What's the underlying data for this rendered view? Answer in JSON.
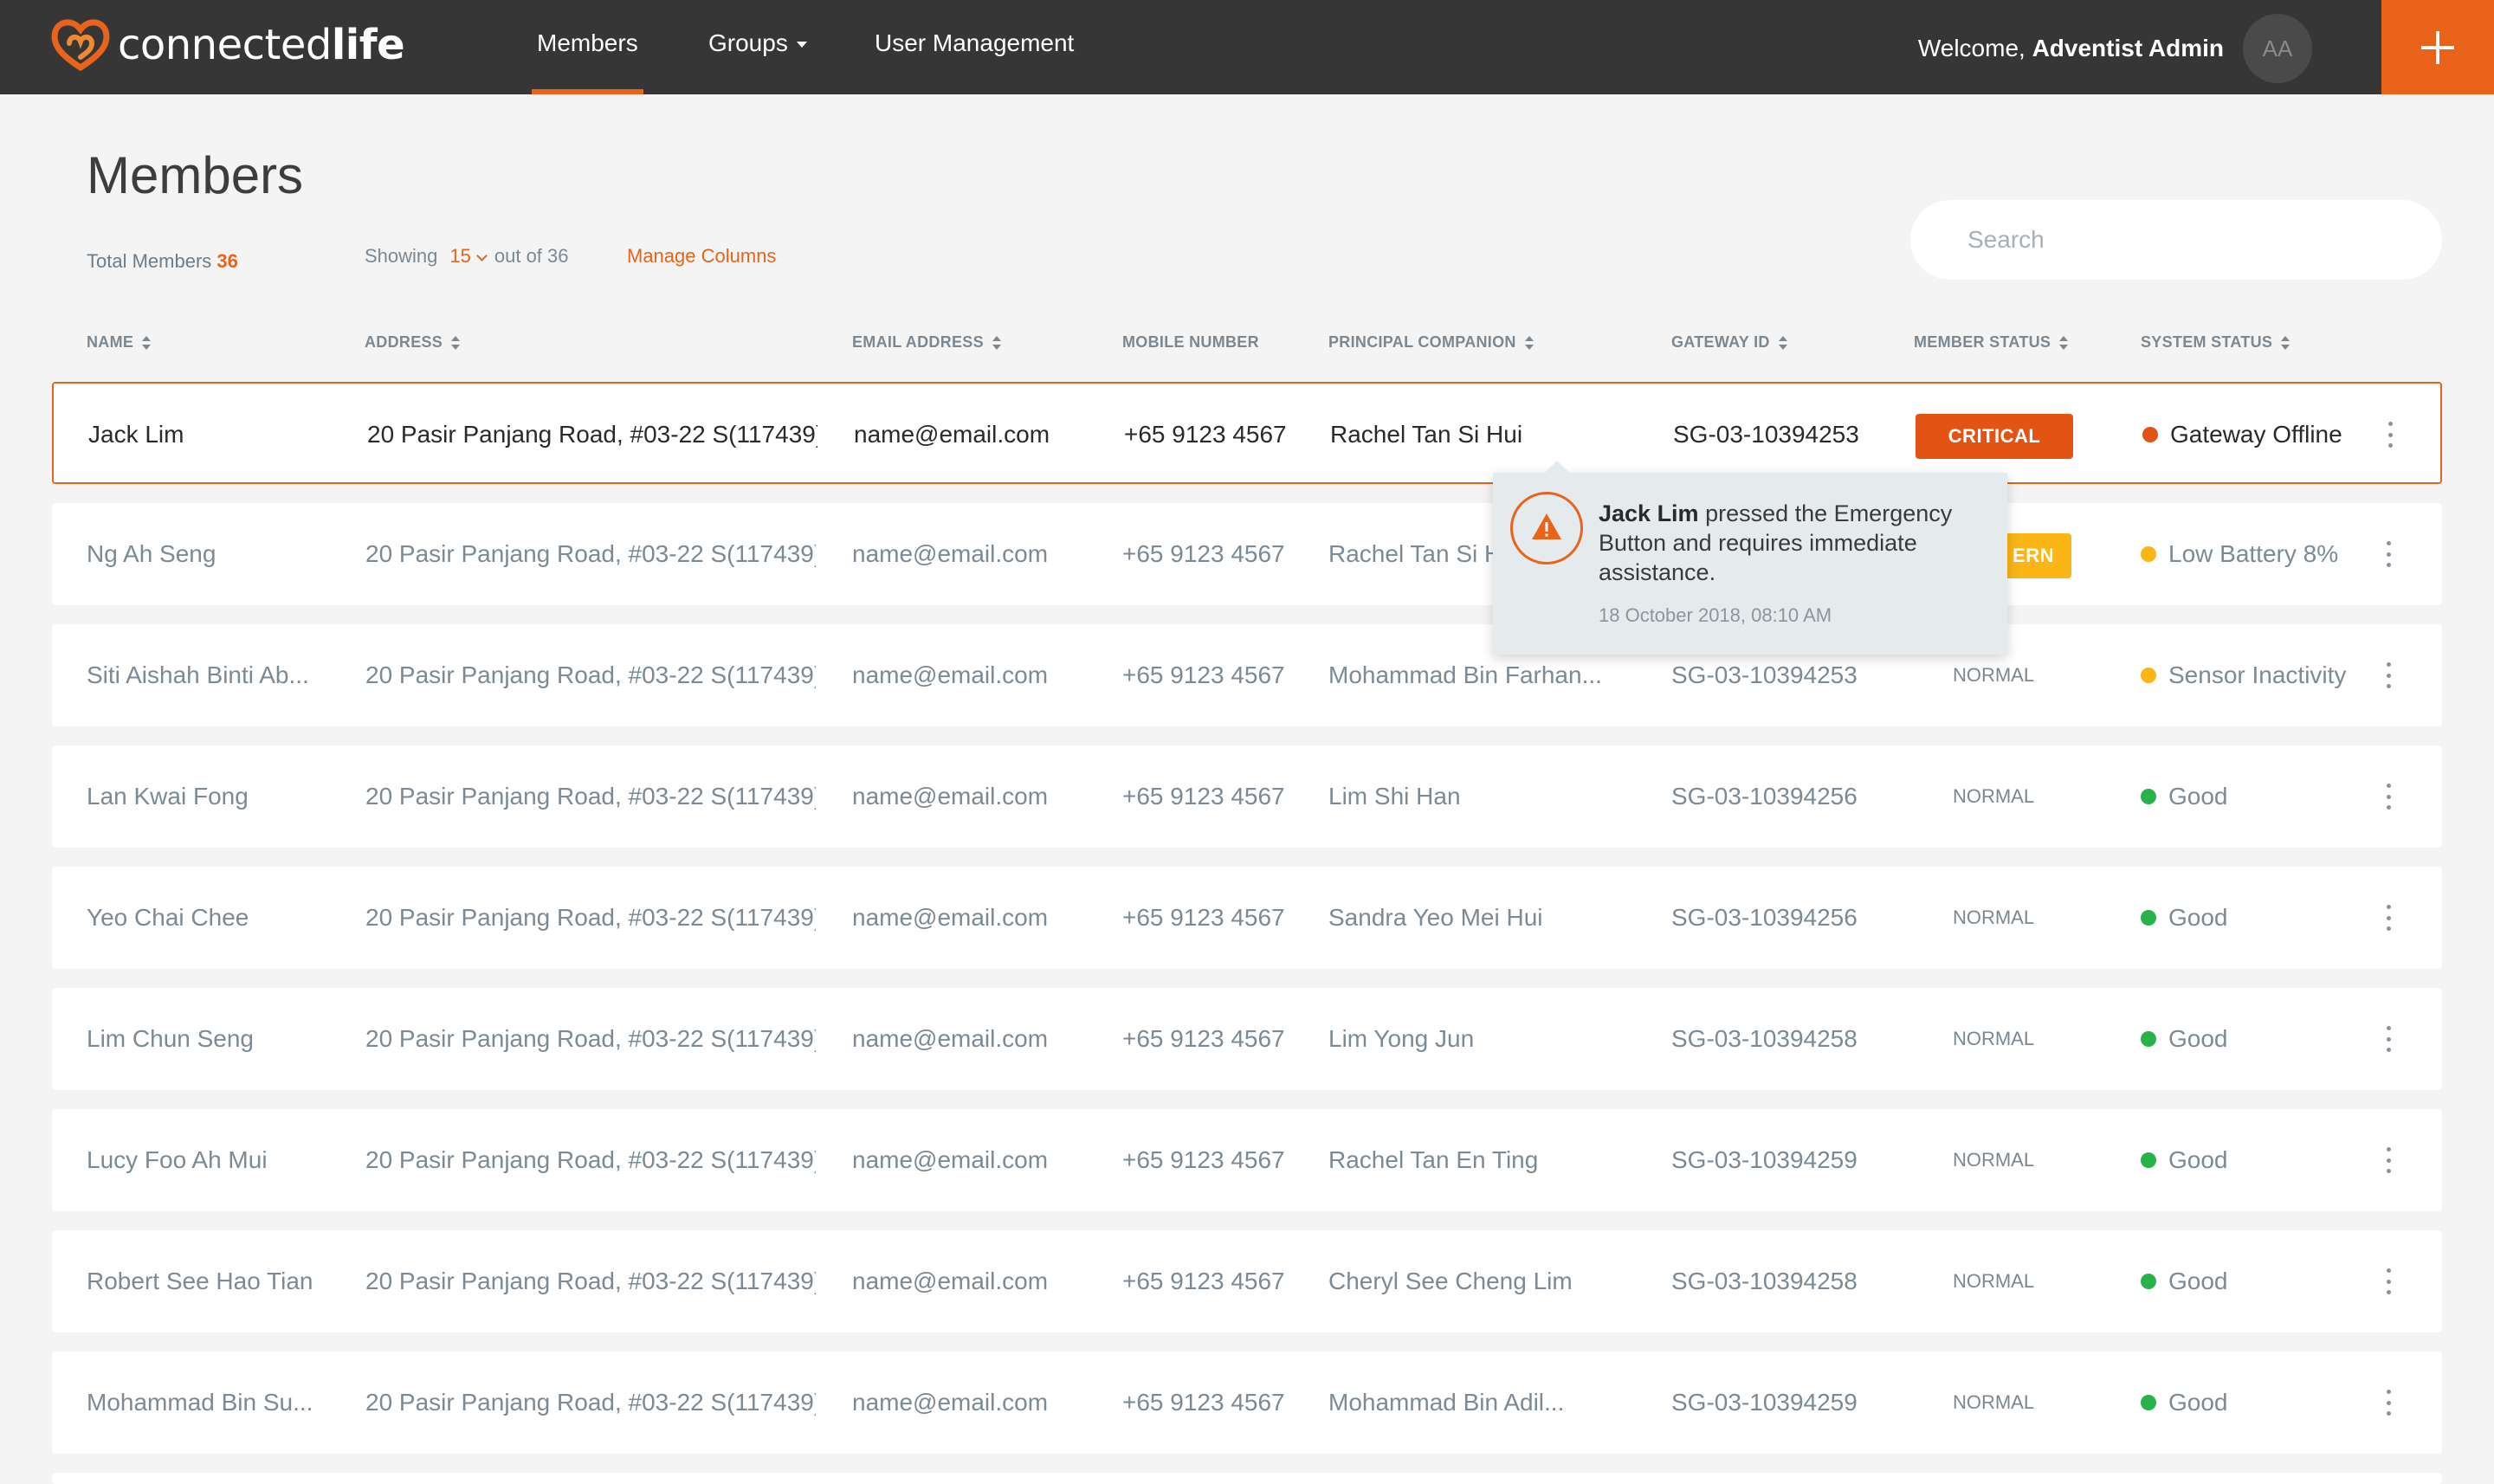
{
  "app": {
    "brand_regular": "connected",
    "brand_bold": "life"
  },
  "nav": {
    "members": "Members",
    "groups": "Groups",
    "user_management": "User Management"
  },
  "user": {
    "welcome_prefix": "Welcome,",
    "name": "Adventist Admin",
    "initials": "AA"
  },
  "page": {
    "title": "Members",
    "total_label": "Total Members",
    "total_count": "36",
    "showing_label": "Showing",
    "showing_value": "15",
    "out_of": "out of 36",
    "manage_columns": "Manage Columns",
    "search_placeholder": "Search"
  },
  "columns": {
    "name": "NAME",
    "address": "ADDRESS",
    "email": "EMAIL ADDRESS",
    "mobile": "MOBILE NUMBER",
    "companion": "PRINCIPAL COMPANION",
    "gateway": "GATEWAY ID",
    "member_status": "MEMBER STATUS",
    "system_status": "SYSTEM  STATUS"
  },
  "rows": [
    {
      "name": "Jack Lim",
      "address": "20 Pasir Panjang Road, #03-22 S(117439)",
      "email": "name@email.com",
      "mobile": "+65 9123 4567",
      "companion": "Rachel Tan Si Hui",
      "gateway": "SG-03-10394253",
      "status": "CRITICAL",
      "system": "Gateway Offline"
    },
    {
      "name": "Ng Ah Seng",
      "address": "20 Pasir Panjang Road, #03-22 S(117439)",
      "email": "name@email.com",
      "mobile": "+65 9123 4567",
      "companion": "Rachel Tan Si H",
      "gateway": "",
      "status": "ERN",
      "system": "Low Battery 8%"
    },
    {
      "name": "Siti Aishah Binti Ab...",
      "address": "20 Pasir Panjang Road, #03-22 S(117439)",
      "email": "name@email.com",
      "mobile": "+65 9123 4567",
      "companion": "Mohammad Bin Farhan...",
      "gateway": "SG-03-10394253",
      "status": "NORMAL",
      "system": "Sensor Inactivity"
    },
    {
      "name": "Lan Kwai Fong",
      "address": "20 Pasir Panjang Road, #03-22 S(117439)",
      "email": "name@email.com",
      "mobile": "+65 9123 4567",
      "companion": "Lim Shi Han",
      "gateway": "SG-03-10394256",
      "status": "NORMAL",
      "system": "Good"
    },
    {
      "name": "Yeo Chai Chee",
      "address": "20 Pasir Panjang Road, #03-22 S(117439)",
      "email": "name@email.com",
      "mobile": "+65 9123 4567",
      "companion": "Sandra Yeo Mei Hui",
      "gateway": "SG-03-10394256",
      "status": "NORMAL",
      "system": "Good"
    },
    {
      "name": "Lim Chun Seng",
      "address": "20 Pasir Panjang Road, #03-22 S(117439)",
      "email": "name@email.com",
      "mobile": "+65 9123 4567",
      "companion": "Lim Yong Jun",
      "gateway": "SG-03-10394258",
      "status": "NORMAL",
      "system": "Good"
    },
    {
      "name": "Lucy Foo Ah Mui",
      "address": "20 Pasir Panjang Road, #03-22 S(117439)",
      "email": "name@email.com",
      "mobile": "+65 9123 4567",
      "companion": "Rachel Tan En Ting",
      "gateway": "SG-03-10394259",
      "status": "NORMAL",
      "system": "Good"
    },
    {
      "name": "Robert See Hao Tian",
      "address": "20 Pasir Panjang Road, #03-22 S(117439)",
      "email": "name@email.com",
      "mobile": "+65 9123 4567",
      "companion": "Cheryl See Cheng Lim",
      "gateway": "SG-03-10394258",
      "status": "NORMAL",
      "system": "Good"
    },
    {
      "name": "Mohammad Bin Su...",
      "address": "20 Pasir Panjang Road, #03-22 S(117439)",
      "email": "name@email.com",
      "mobile": "+65 9123 4567",
      "companion": "Mohammad Bin Adil...",
      "gateway": "SG-03-10394259",
      "status": "NORMAL",
      "system": "Good"
    }
  ],
  "tooltip": {
    "name": "Jack Lim",
    "message": "pressed the Emergency Button and requires immediate assistance.",
    "time": "18 October 2018, 08:10 AM"
  },
  "colors": {
    "accent": "#e9631b",
    "critical": "#e35314",
    "concern": "#fbb516",
    "good": "#2ab24a",
    "warning": "#fbb516",
    "offline": "#e35314"
  }
}
